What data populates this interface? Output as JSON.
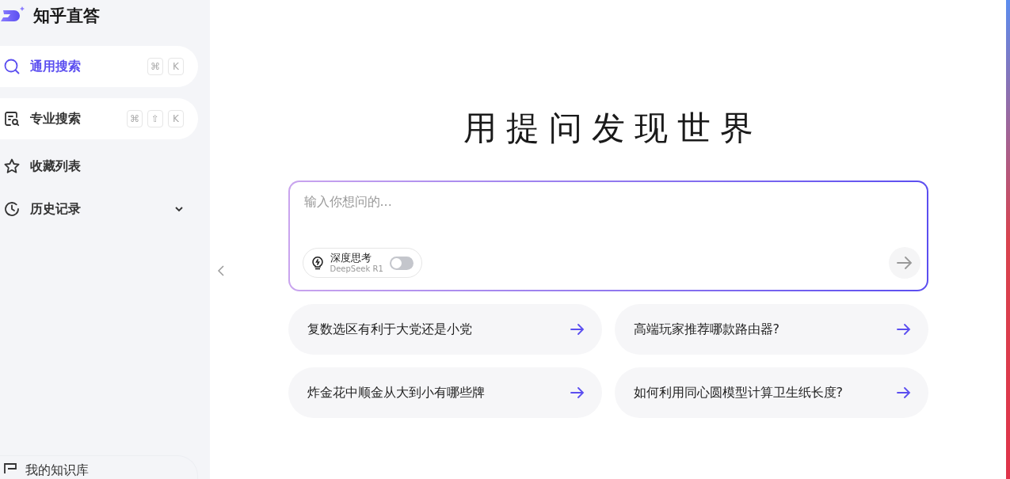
{
  "sidebar": {
    "brand": "知乎直答",
    "items": [
      {
        "kind": "search",
        "label": "通用搜索",
        "selected": true,
        "keys": [
          "⌘",
          "K"
        ]
      },
      {
        "kind": "pro",
        "label": "专业搜索",
        "selected": false,
        "keys": [
          "⌘",
          "⇧",
          "K"
        ]
      },
      {
        "kind": "star",
        "label": "收藏列表",
        "selected": false
      },
      {
        "kind": "history",
        "label": "历史记录",
        "selected": false,
        "expanded": false
      }
    ],
    "bottom_item": {
      "label": "我的知识库"
    }
  },
  "main": {
    "title": "用提问发现世界",
    "query": {
      "placeholder": "输入你想问的...",
      "deep_think": {
        "label": "深度思考",
        "sublabel": "DeepSeek R1",
        "on": false
      }
    },
    "suggestions": [
      "复数选区有利于大党还是小党",
      "高端玩家推荐哪款路由器?",
      "炸金花中顺金从大到小有哪些牌",
      "如何利用同心圆模型计算卫生纸长度?"
    ]
  }
}
